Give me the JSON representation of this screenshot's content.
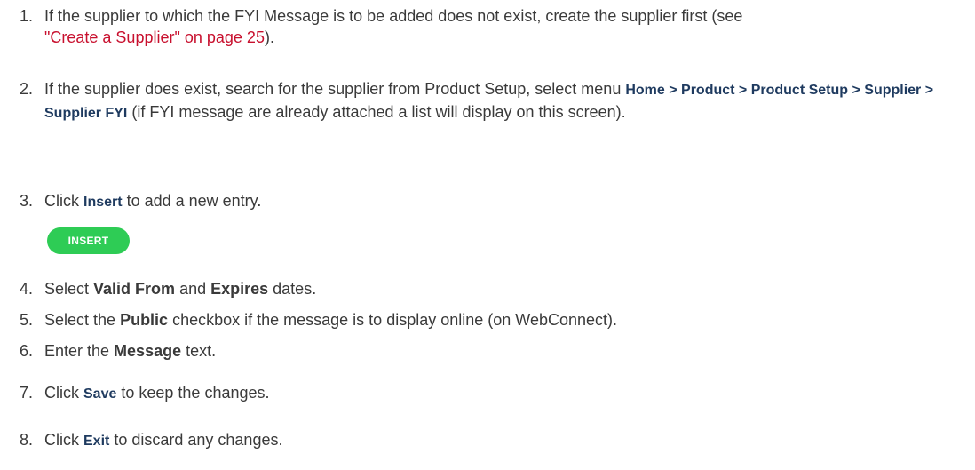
{
  "steps": [
    {
      "num": "1.",
      "line1_pre": "If the supplier to which the FYI Message is to be added does not exist, create the supplier first (see",
      "xref": "\"Create a Supplier\" on page 25",
      "line2_post": ")."
    },
    {
      "num": "2.",
      "pre": "If the supplier does exist, search for the supplier from Product Setup, select menu ",
      "menu_path": "Home > Product > Product Setup > Supplier > Supplier FYI",
      "post": " (if FYI message are already attached a list will display on this screen)."
    },
    {
      "num": "3.",
      "pre": "Click ",
      "ui": "Insert",
      "post": " to add a new entry."
    },
    {
      "num": "4.",
      "pre": "Select ",
      "b1": "Valid From",
      "mid": " and ",
      "b2": "Expires",
      "post": " dates."
    },
    {
      "num": "5.",
      "pre": "Select the ",
      "b1": "Public",
      "post": " checkbox if the message is to display online (on WebConnect)."
    },
    {
      "num": "6.",
      "pre": "Enter the ",
      "b1": "Message",
      "post": " text."
    },
    {
      "num": "7.",
      "pre": "Click ",
      "ui": "Save",
      "post": " to keep the changes."
    },
    {
      "num": "8.",
      "pre": "Click ",
      "ui": "Exit",
      "post": " to discard any changes."
    }
  ],
  "insert_button_label": "INSERT",
  "colors": {
    "text": "#3a3a3a",
    "ui_term": "#1e3a5f",
    "link": "#c8102e",
    "button": "#2ecc55"
  }
}
